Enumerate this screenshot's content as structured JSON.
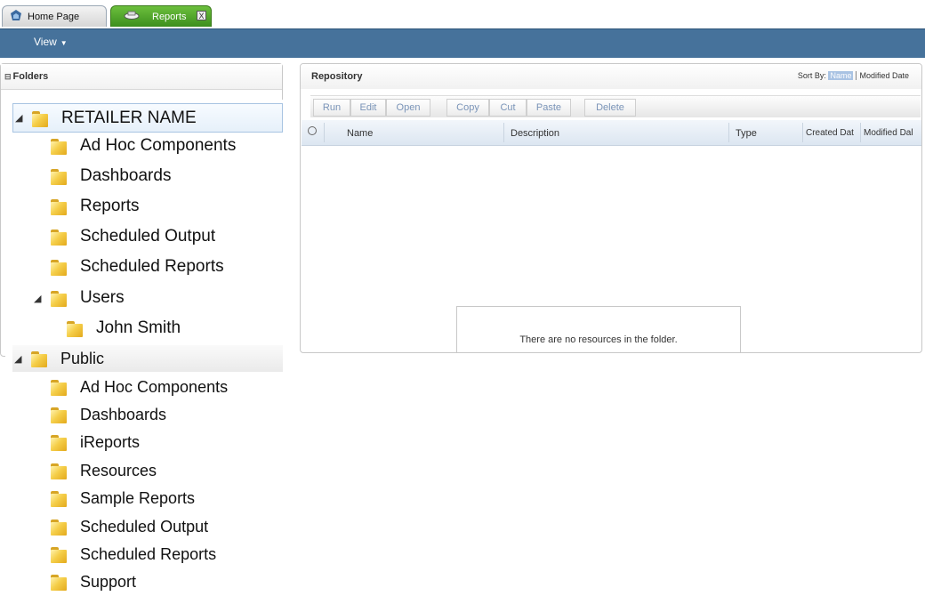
{
  "tabs": [
    {
      "label": "Home Page",
      "icon": "home-icon",
      "active": false
    },
    {
      "label": "Reports",
      "icon": "reports-icon",
      "active": true,
      "close_label": "X"
    }
  ],
  "menu": {
    "view_label": "View",
    "view_caret": "▼"
  },
  "folders_panel": {
    "title": "Folders"
  },
  "repository": {
    "title": "Repository",
    "sort_by_label": "Sort By:",
    "sort_options": [
      "Name",
      "Modified Date"
    ],
    "sort_active": "Name",
    "toolbar": [
      "Run",
      "Edit",
      "Open",
      "Copy",
      "Cut",
      "Paste",
      "Delete"
    ],
    "columns": [
      "Name",
      "Description",
      "Type",
      "Created Dat",
      "Modified Dal"
    ],
    "empty_message": "There are no resources in the folder."
  },
  "tree": {
    "root1": {
      "label": "RETAILER NAME",
      "children": [
        "Ad Hoc Components",
        "Dashboards",
        "Reports",
        "Scheduled Output",
        "Scheduled Reports"
      ],
      "users": {
        "label": "Users",
        "children": [
          "John Smith"
        ]
      }
    },
    "root2": {
      "label": "Public",
      "children": [
        "Ad Hoc Components",
        "Dashboards",
        "iReports",
        "Resources",
        "Sample Reports",
        "Scheduled Output",
        "Scheduled Reports",
        "Support"
      ]
    }
  },
  "colors": {
    "menubar": "#46729b",
    "active_tab": "#4fa12a",
    "selection": "#e6f0fa"
  }
}
